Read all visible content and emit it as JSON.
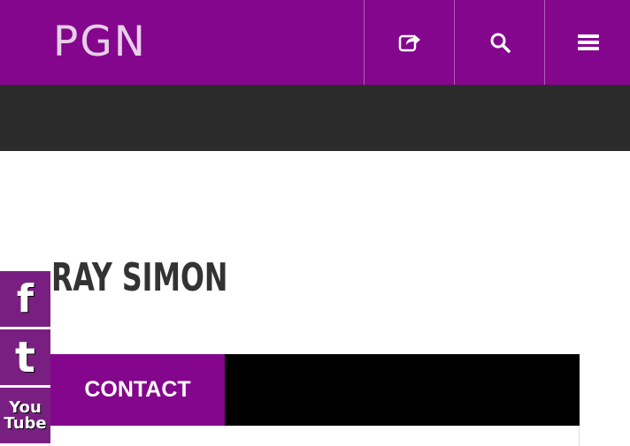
{
  "header": {
    "logo_text": "PGN",
    "buttons": [
      {
        "name": "share",
        "icon": "share-icon"
      },
      {
        "name": "search",
        "icon": "search-icon"
      },
      {
        "name": "menu",
        "icon": "hamburger-menu-icon"
      }
    ],
    "background_color": "#84068c"
  },
  "subbar": {
    "background_color": "#2b2b2b"
  },
  "page": {
    "title": "RAY SIMON"
  },
  "social": {
    "facebook_glyph": "f",
    "twitter_glyph": "t",
    "youtube_line1": "You",
    "youtube_line2": "Tube"
  },
  "contact": {
    "tab_label": "CONTACT"
  }
}
